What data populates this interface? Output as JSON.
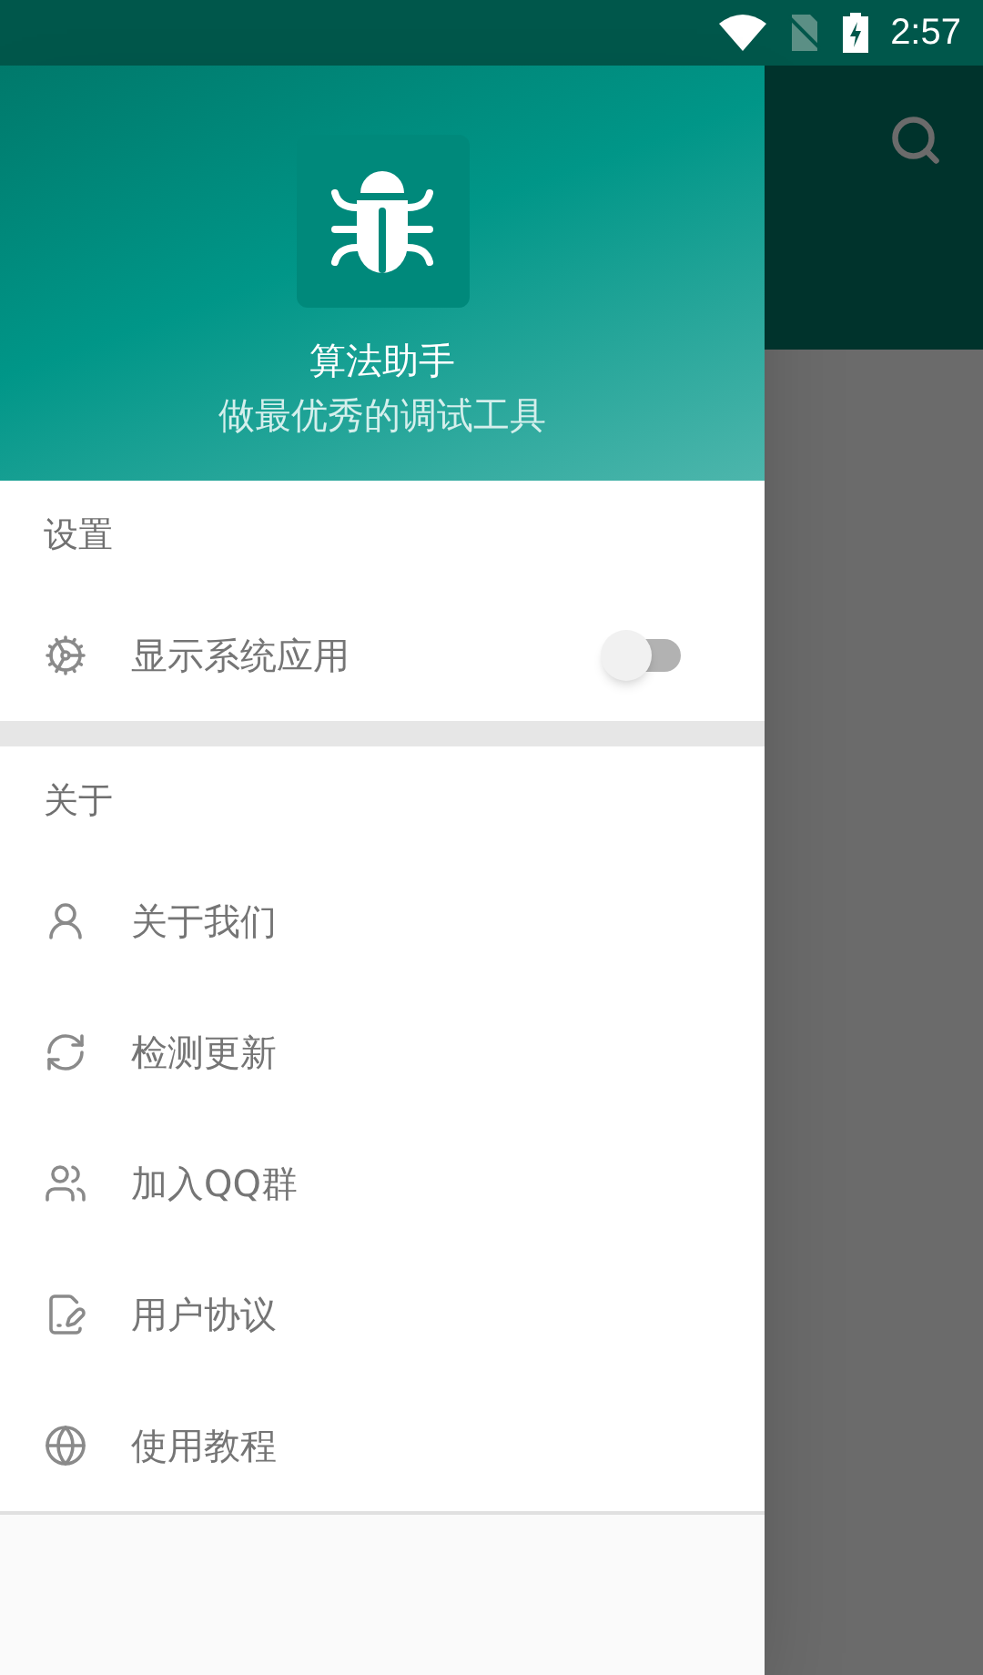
{
  "status_bar": {
    "time": "2:57"
  },
  "drawer": {
    "app_name": "算法助手",
    "tagline": "做最优秀的调试工具",
    "sections": [
      {
        "title": "设置",
        "items": [
          {
            "kind": "toggle",
            "label": "显示系统应用",
            "on": false
          }
        ]
      },
      {
        "title": "关于",
        "items": [
          {
            "kind": "link",
            "label": "关于我们"
          },
          {
            "kind": "link",
            "label": "检测更新"
          },
          {
            "kind": "link",
            "label": "加入QQ群"
          },
          {
            "kind": "link",
            "label": "用户协议"
          },
          {
            "kind": "link",
            "label": "使用教程"
          }
        ]
      }
    ]
  }
}
